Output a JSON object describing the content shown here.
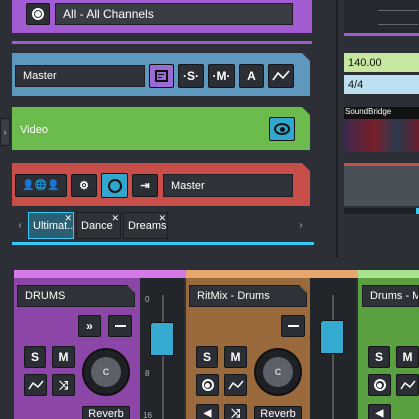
{
  "top_track": {
    "channel_filter": "All - All Channels"
  },
  "master_track": {
    "name": "Master",
    "buttons": {
      "notes": "notes",
      "solo": "·S·",
      "mute": "·M·",
      "arm": "A"
    }
  },
  "video_track": {
    "name": "Video"
  },
  "red_track": {
    "name": "Master"
  },
  "tabs": [
    {
      "label": "Ultimat..."
    },
    {
      "label": "Dance"
    },
    {
      "label": "Dreams..."
    }
  ],
  "right_panel": {
    "tempo": "140.00",
    "time_signature": "4/4",
    "thumbnail_label": "SoundBridge"
  },
  "mixer": {
    "channels": [
      {
        "name": "DRUMS",
        "solo": "S",
        "mute": "M",
        "knob": "C",
        "reverb": "Reverb"
      },
      {
        "name": "RitMix - Drums",
        "solo": "S",
        "mute": "M",
        "knob": "C",
        "reverb": "Reverb"
      },
      {
        "name": "Drums - Ml",
        "solo": "S",
        "mute": "M"
      }
    ],
    "scale": [
      "0",
      "8",
      "16"
    ]
  },
  "colors": {
    "background": "#2c2f36",
    "top": "#a15cd2",
    "master": "#5e98bf",
    "video": "#6cbc4d",
    "red": "#c84f49",
    "mixer_purple": "#8c46a7",
    "mixer_orange": "#9a6a3c",
    "mixer_green": "#5aa040",
    "accent": "#35c9f7"
  }
}
